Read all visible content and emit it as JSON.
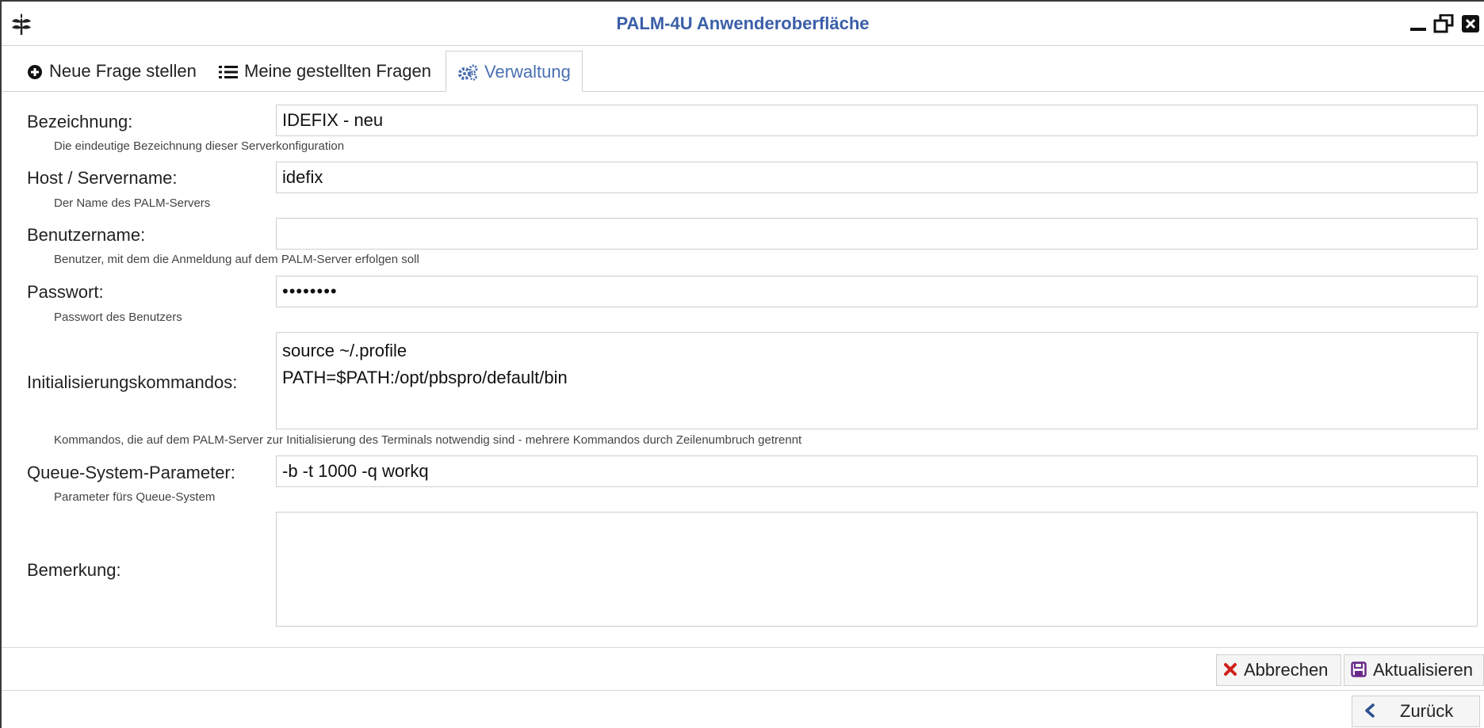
{
  "window": {
    "title": "PALM-4U Anwenderoberfläche",
    "logo_icon": "plant-icon",
    "accent_color": "#3a5fa8"
  },
  "tabs": [
    {
      "label": "Neue Frage stellen",
      "icon": "plus-circle-icon"
    },
    {
      "label": "Meine gestellten Fragen",
      "icon": "list-icon"
    },
    {
      "label": "Verwaltung",
      "icon": "gears-icon",
      "active": true
    }
  ],
  "form": {
    "bezeichnung": {
      "label": "Bezeichnung:",
      "value": "IDEFIX - neu",
      "help": "Die eindeutige Bezeichnung dieser Serverkonfiguration"
    },
    "host": {
      "label": "Host / Servername:",
      "value": "idefix",
      "help": "Der Name des PALM-Servers"
    },
    "benutzer": {
      "label": "Benutzername:",
      "value": "",
      "help": "Benutzer, mit dem die Anmeldung auf dem PALM-Server erfolgen soll"
    },
    "passwort": {
      "label": "Passwort:",
      "value": "••••••••",
      "help": "Passwort des Benutzers"
    },
    "init": {
      "label": "Initialisierungskommandos:",
      "value": "source ~/.profile\nPATH=$PATH:/opt/pbspro/default/bin",
      "help": "Kommandos, die auf dem PALM-Server zur Initialisierung des Terminals notwendig sind - mehrere Kommandos durch Zeilenumbruch getrennt"
    },
    "queue": {
      "label": "Queue-System-Parameter:",
      "value": "-b -t 1000 -q workq",
      "help": "Parameter fürs Queue-System"
    },
    "bemerkung": {
      "label": "Bemerkung:",
      "value": ""
    }
  },
  "buttons": {
    "cancel": "Abbrechen",
    "update": "Aktualisieren",
    "back": "Zurück"
  },
  "colors": {
    "cancel_icon": "#d0201a",
    "update_icon": "#6a2a8a",
    "back_icon": "#2c4f8f"
  }
}
